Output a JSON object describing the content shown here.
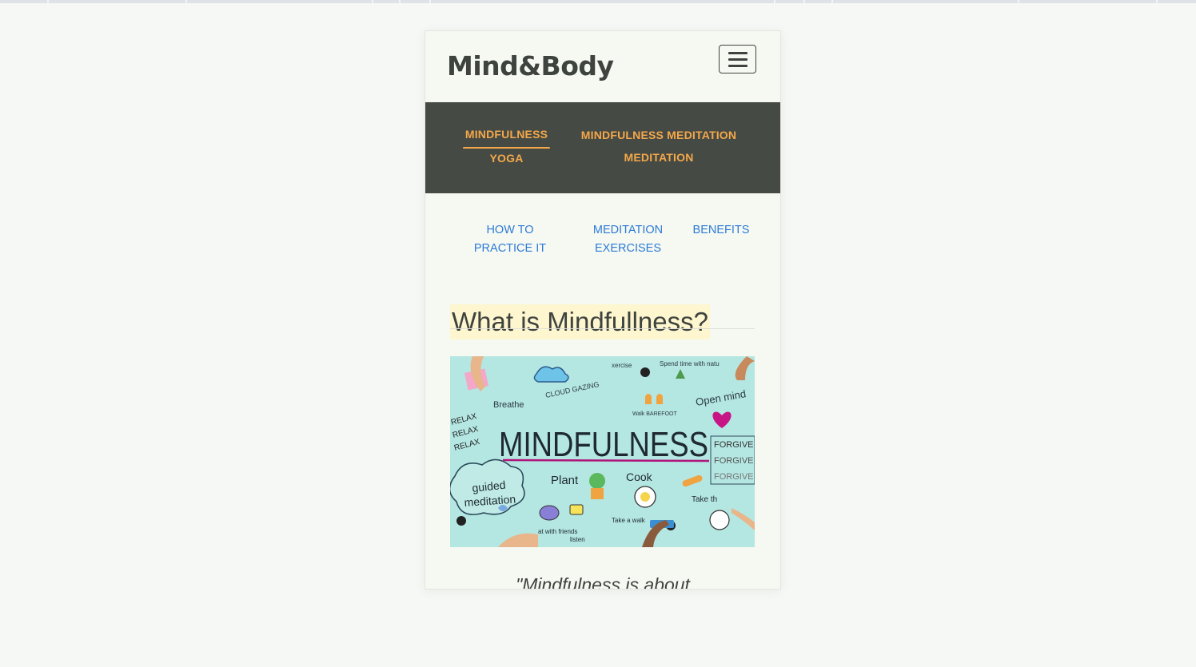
{
  "header": {
    "brand": "Mind&Body",
    "menu_icon": "hamburger-icon"
  },
  "nav": {
    "items": [
      {
        "label": "MINDFULNESS",
        "active": true
      },
      {
        "label": "MINDFULNESS MEDITATION",
        "active": false
      },
      {
        "label": "YOGA",
        "active": false
      },
      {
        "label": "MEDITATION",
        "active": false
      }
    ]
  },
  "subnav": {
    "items": [
      {
        "line1": "HOW TO",
        "line2": "PRACTICE IT"
      },
      {
        "line1": "MEDITATION",
        "line2": "EXERCISES"
      },
      {
        "line1": "BENEFITS",
        "line2": ""
      }
    ]
  },
  "main": {
    "title": "What is Mindfullness?",
    "image": {
      "main_word": "MINDFULNESS",
      "doodles": [
        "Breathe",
        "CLOUD GAZING",
        "xercise",
        "Spend time with natu",
        "Walk BAREFOOT",
        "Open mind",
        "RELAX",
        "RELAX",
        "RELAX",
        "FORGIVE",
        "FORGIVE",
        "FORGIVE",
        "guided",
        "meditation",
        "Plant",
        "Cook",
        "Take th",
        "Take a walk",
        "at with friends",
        "listen"
      ]
    },
    "quote_partial": "\"Mindfulness is about"
  },
  "colors": {
    "page_bg": "#f6f8f5",
    "card_bg": "#f5f9f2",
    "nav_bg": "#454a44",
    "nav_text": "#f4a84a",
    "link": "#2e7ad6",
    "heading_highlight": "#fdf6cf",
    "text_dark": "#3f433f"
  }
}
